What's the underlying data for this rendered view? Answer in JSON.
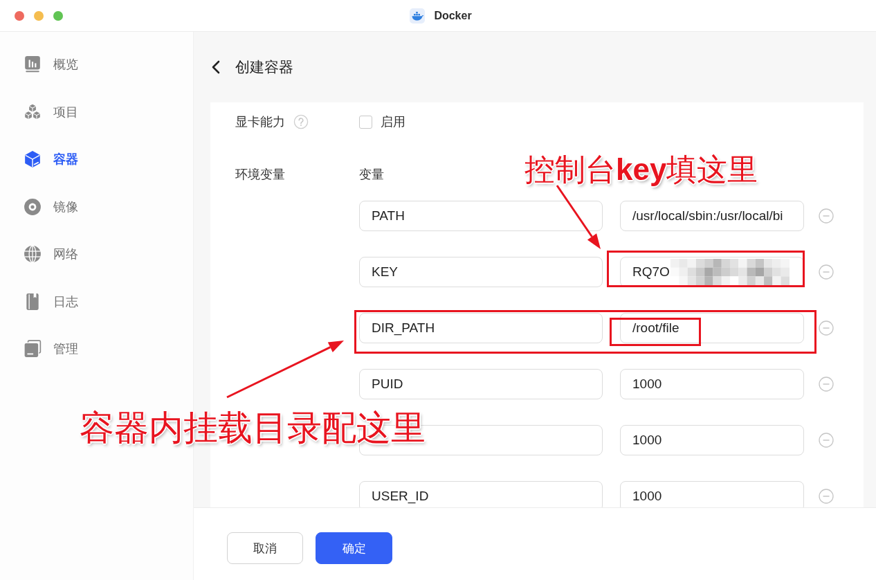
{
  "window": {
    "title": "Docker"
  },
  "sidebar": {
    "items": [
      {
        "kind": "overview",
        "label": "概览",
        "selected": false
      },
      {
        "kind": "projects",
        "label": "项目",
        "selected": false
      },
      {
        "kind": "containers",
        "label": "容器",
        "selected": true
      },
      {
        "kind": "images",
        "label": "镜像",
        "selected": false
      },
      {
        "kind": "network",
        "label": "网络",
        "selected": false
      },
      {
        "kind": "logs",
        "label": "日志",
        "selected": false
      },
      {
        "kind": "manage",
        "label": "管理",
        "selected": false
      }
    ]
  },
  "page": {
    "title": "创建容器"
  },
  "form": {
    "gpu": {
      "label": "显卡能力",
      "option": {
        "label": "启用",
        "checked": false
      }
    },
    "env": {
      "label": "环境变量",
      "key_header": "变量",
      "rows": [
        {
          "key": "PATH",
          "value": "/usr/local/sbin:/usr/local/bi",
          "redacted": false,
          "field_marked": false,
          "row_marked": false,
          "text_marked": false
        },
        {
          "key": "KEY",
          "value": "RQ7O",
          "redacted": true,
          "field_marked": true,
          "row_marked": false,
          "text_marked": false
        },
        {
          "key": "DIR_PATH",
          "value": "/root/file",
          "redacted": false,
          "field_marked": false,
          "row_marked": true,
          "text_marked": true
        },
        {
          "key": "PUID",
          "value": "1000",
          "redacted": false,
          "field_marked": false,
          "row_marked": false,
          "text_marked": false
        },
        {
          "value": "1000",
          "redacted": false,
          "field_marked": false,
          "row_marked": false,
          "text_marked": false
        },
        {
          "key": "USER_ID",
          "value": "1000",
          "redacted": false,
          "field_marked": false,
          "row_marked": false,
          "text_marked": false
        }
      ]
    }
  },
  "footer": {
    "buttons": [
      {
        "kind": "secondary",
        "label": "取消"
      },
      {
        "kind": "primary",
        "label": "确定"
      }
    ]
  },
  "annotations": [
    {
      "text": "控制台**key**填这里"
    },
    {
      "text": "容器内挂载目录配这里"
    }
  ]
}
